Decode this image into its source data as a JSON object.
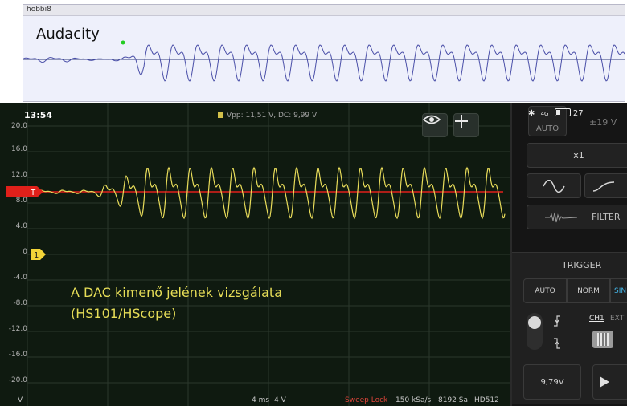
{
  "audacity": {
    "window_title": "hobbi8",
    "track_label": "Audacity"
  },
  "status": {
    "time": "13:54",
    "battery": "27"
  },
  "measurement": "Vpp: 11,51 V, DC: 9,99 V",
  "y_axis_labels": [
    "20.0",
    "16.0",
    "12.0",
    "8.0",
    "4.0",
    "0",
    "-4.0",
    "-8.0",
    "-12.0",
    "-16.0",
    "-20.0"
  ],
  "y_unit": "V",
  "channel_marker": "1",
  "trigger_marker": "T",
  "caption": {
    "line1": "A DAC kimenő jelének vizsgálata",
    "line2": "(HS101/HScope)"
  },
  "bottom_bar": {
    "timebase": "4 ms",
    "volts_div": "4 V",
    "sweep_mode": "Sweep Lock",
    "sample_rate": "150 kSa/s",
    "samples": "8192 Sa",
    "device": "HD512"
  },
  "panel": {
    "auto_label": "AUTO",
    "voltage_display": "±19 V",
    "multiplier": "x1",
    "filter_label": "FILTER",
    "trigger_title": "TRIGGER",
    "trigger_modes": [
      "AUTO",
      "NORM",
      "SIN"
    ],
    "source_ch1": "CH1",
    "source_ext": "EXT",
    "trigger_level": "9,79V"
  },
  "colors": {
    "scope_background": "#0f1a10",
    "grid": "#2b382c",
    "signal": "#e8dc5a",
    "trigger_line": "#e0201a",
    "audacity_wave": "#4a4fa8"
  }
}
